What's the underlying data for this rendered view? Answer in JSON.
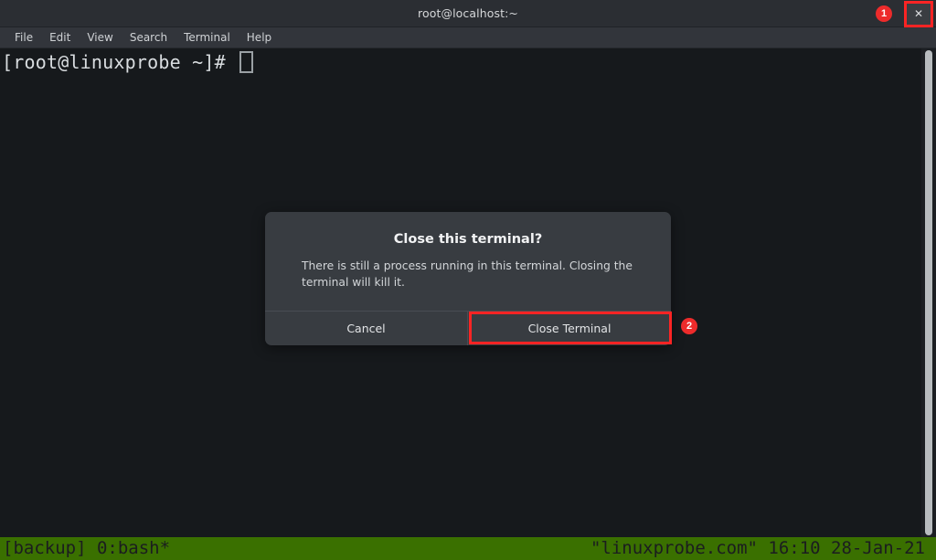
{
  "window": {
    "title": "root@localhost:~",
    "close_icon": "✕"
  },
  "annotations": {
    "badge_1": "1",
    "badge_2": "2",
    "highlight_color": "#fc2424"
  },
  "menubar": {
    "items": [
      {
        "label": "File"
      },
      {
        "label": "Edit"
      },
      {
        "label": "View"
      },
      {
        "label": "Search"
      },
      {
        "label": "Terminal"
      },
      {
        "label": "Help"
      }
    ]
  },
  "terminal": {
    "prompt_line": "[root@linuxprobe ~]# ",
    "background": "#16191c",
    "foreground": "#d9dde0"
  },
  "statusbar": {
    "left": "[backup] 0:bash*",
    "right": "\"linuxprobe.com\" 16:10 28-Jan-21",
    "background": "#3a7000",
    "foreground": "#1b1d1f"
  },
  "dialog": {
    "title": "Close this terminal?",
    "message": "There is still a process running in this terminal. Closing the terminal will kill it.",
    "cancel_label": "Cancel",
    "confirm_label": "Close Terminal"
  }
}
